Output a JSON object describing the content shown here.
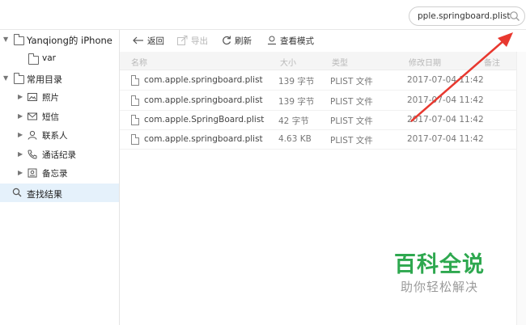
{
  "search": {
    "value": "pple.springboard.plist"
  },
  "sidebar": {
    "device": "Yanqiong的 iPhone",
    "var_folder": "var",
    "common_dirs": "常用目录",
    "items": [
      {
        "label": "照片",
        "icon": "photo-icon"
      },
      {
        "label": "短信",
        "icon": "mail-icon"
      },
      {
        "label": "联系人",
        "icon": "person-icon"
      },
      {
        "label": "通话纪录",
        "icon": "phone-icon"
      },
      {
        "label": "备忘录",
        "icon": "memo-icon"
      }
    ],
    "search_results": "查找结果"
  },
  "toolbar": {
    "back": "返回",
    "export": "导出",
    "refresh": "刷新",
    "view_mode": "查看模式"
  },
  "table": {
    "headers": {
      "name": "名称",
      "size": "大小",
      "type": "类型",
      "date": "修改日期",
      "note": "备注"
    },
    "rows": [
      {
        "name": "com.apple.springboard.plist",
        "size": "139 字节",
        "type": "PLIST 文件",
        "date": "2017-07-04 11:42"
      },
      {
        "name": "com.apple.springboard.plist",
        "size": "139 字节",
        "type": "PLIST 文件",
        "date": "2017-07-04 11:42"
      },
      {
        "name": "com.apple.SpringBoard.plist",
        "size": "42 字节",
        "type": "PLIST 文件",
        "date": "2017-07-04 11:42"
      },
      {
        "name": "com.apple.springboard.plist",
        "size": "4.63 KB",
        "type": "PLIST 文件",
        "date": "2017-07-04 11:42"
      }
    ]
  },
  "watermark": {
    "title": "百科全说",
    "subtitle": "助你轻松解决"
  },
  "colors": {
    "arrow": "#e8382f",
    "watermark": "#2ea84f",
    "selected": "#e5f1fb"
  }
}
